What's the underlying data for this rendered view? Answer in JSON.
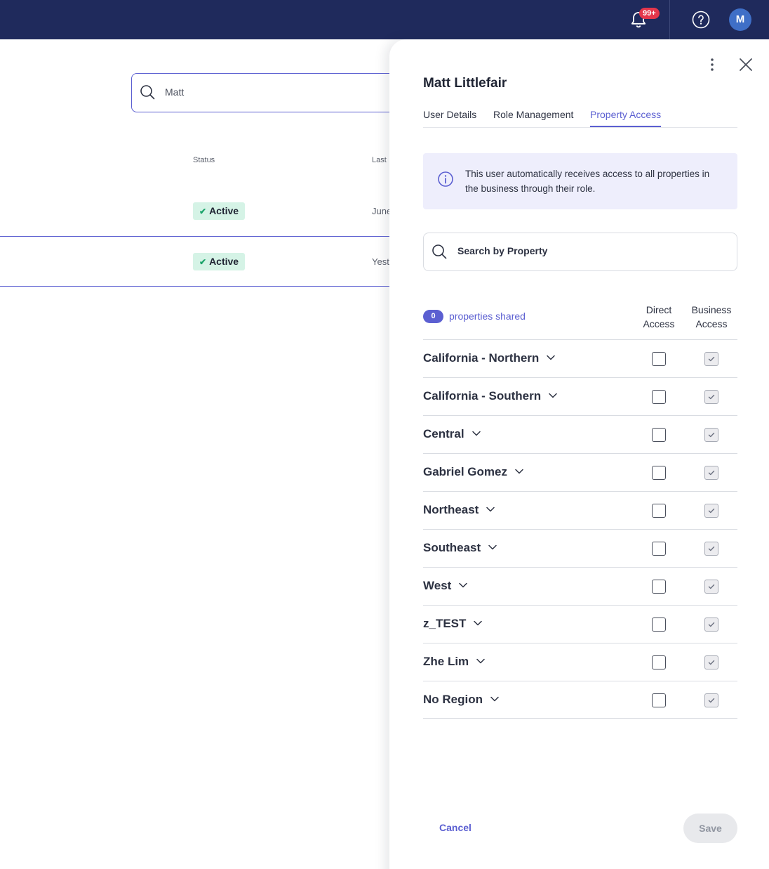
{
  "topbar": {
    "notification_badge": "99+",
    "avatar_initial": "M"
  },
  "background_page": {
    "search_value": "Matt",
    "columns": {
      "status": "Status",
      "last": "Last"
    },
    "rows": [
      {
        "status": "Active",
        "last": "June"
      },
      {
        "status": "Active",
        "last": "Yest"
      }
    ]
  },
  "drawer": {
    "title": "Matt Littlefair",
    "tabs": [
      {
        "label": "User Details"
      },
      {
        "label": "Role Management"
      },
      {
        "label": "Property Access"
      }
    ],
    "info_text": "This user automatically receives access to all properties in the business through their role.",
    "search_placeholder": "Search by Property",
    "shared_count": "0",
    "shared_label": "properties shared",
    "columns": {
      "direct": {
        "line1": "Direct",
        "line2": "Access"
      },
      "business": {
        "line1": "Business",
        "line2": "Access"
      }
    },
    "regions": [
      {
        "name": "California - Northern",
        "direct": false,
        "business": true
      },
      {
        "name": "California - Southern",
        "direct": false,
        "business": true
      },
      {
        "name": "Central",
        "direct": false,
        "business": true
      },
      {
        "name": "Gabriel Gomez",
        "direct": false,
        "business": true
      },
      {
        "name": "Northeast",
        "direct": false,
        "business": true
      },
      {
        "name": "Southeast",
        "direct": false,
        "business": true
      },
      {
        "name": "West",
        "direct": false,
        "business": true
      },
      {
        "name": "z_TEST",
        "direct": false,
        "business": true
      },
      {
        "name": "Zhe Lim",
        "direct": false,
        "business": true
      },
      {
        "name": "No Region",
        "direct": false,
        "business": true
      }
    ],
    "cancel_label": "Cancel",
    "save_label": "Save"
  },
  "colors": {
    "topbar": "#1f2a5c",
    "accent": "#5b5fd1",
    "badge": "#e5364b",
    "status_bg": "#d5f3e6",
    "status_check": "#1aa36a"
  }
}
